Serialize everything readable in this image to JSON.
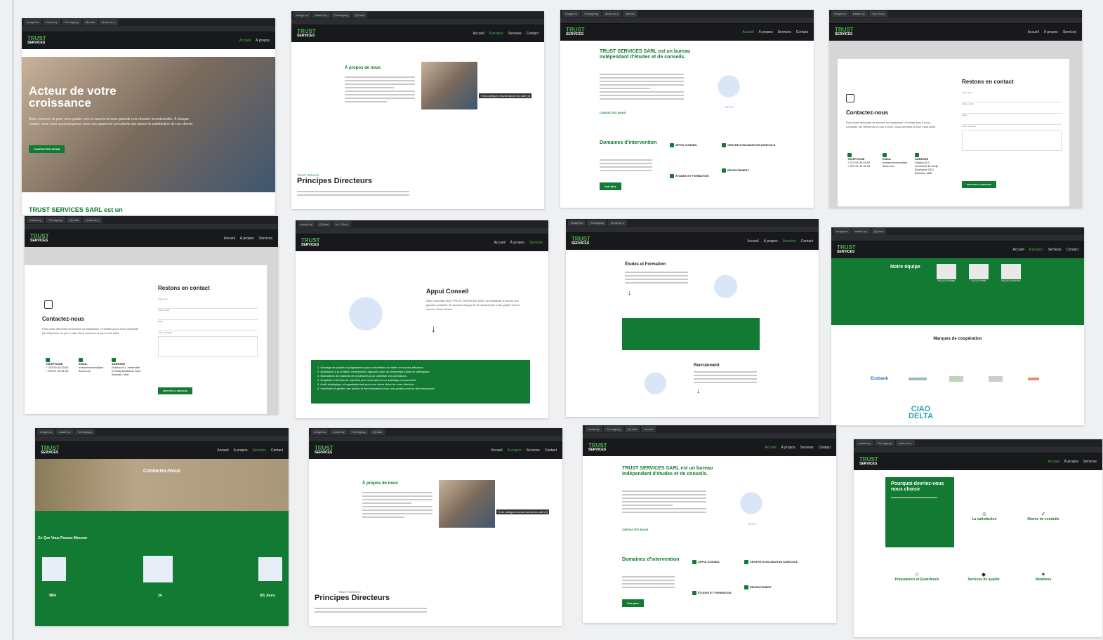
{
  "tabs": [
    "Image tra",
    "ewast loy",
    "Témoignag",
    "(3) Asal",
    "photo de p",
    "tra - Rech",
    "batmail",
    "Sites & ser",
    "Your Repo",
    "Accueil"
  ],
  "nav": {
    "home": "Accueil",
    "about": "À propos",
    "services": "Services",
    "contact": "Contact"
  },
  "logo": {
    "line1": "TRUST",
    "line2": "SERVICES"
  },
  "hero": {
    "title": "Acteur de votre croissance",
    "text": "Nous sommes là pour vous guider vers le succès et vous garantir une réussite incontestable. À chaque instant, nous vous accompagnons avec une approche percutante qui assure la satisfaction de nos clients.",
    "button": "CONTACTEZ-NOUS",
    "below": "TRUST SERVICES SARL est un"
  },
  "about": {
    "title": "À propos de nous",
    "caption": "Trois collègues travail durant du café (3)",
    "tag": "TRUST SERVICE",
    "principles": "Principes Directeurs"
  },
  "intro": {
    "title": "TRUST SERVICES SARL est un bureau indépendant d'études et de conseils.",
    "link": "CONTACTEZ-NOUS",
    "badge": "TRUST",
    "domains": "Domaines d'intervention",
    "more": "Voir plus",
    "d1": "APPUI CONSEIL",
    "d2": "CENTRE D'INCUBATION AGRICOLE",
    "d3": "ÉTUDES ET FORMATION",
    "d4": "RECRUTEMENT"
  },
  "contact": {
    "title": "Restons en contact",
    "left": "Contactez-nous",
    "text": "Pour toute demande de service ou assistance, n'hésitez pas à nous contacter par téléphone ou par e-mail. Nous sommes là pour vous aider.",
    "f_name": "Votre nom",
    "f_mail": "Votre e-mail",
    "f_obj": "Objet",
    "f_msg": "Votre message",
    "send": "ENVOYER LE MESSAGE",
    "tel_label": "TÉLÉPHONE",
    "tel": "+ 223 90 34 53 60",
    "tel2": "+ 223 91 45 56 33",
    "mail_label": "EMAIL",
    "mail": "trustservicesml@ba",
    "mail2": "ffooll.com",
    "addr_label": "ADRESSE",
    "addr": "Sotuba ACI, Immeuble El Hadji Boubacar SAO Bamako, Mali"
  },
  "appui": {
    "title": "Appui Conseil",
    "text": "Notre expertise chez TRUST SERVICES SARL se manifeste à travers une gamme complète de services d'appui et de conseil pour vous guider vers le succès. Nous offrons :",
    "l1": "1. Montage de projets et programmes pour concrétiser vos idées en succès efficaces.",
    "l2": "2. Assistance à la création d'entreprises agricoles pour un démarrage solide et stratégique.",
    "l3": "3. Élaboration de manuels de procédures pour optimiser vos opérations.",
    "l4": "4. Enquêtes et études de marchés pour vous donner un avantage concurrentiel.",
    "l5": "5. Audit stratégique et organisationnel pour une vision claire de votre direction.",
    "l6": "6. Inventaire et gestion des stocks et immobilisations pour une gestion précise des ressources."
  },
  "etudes": {
    "title": "Études et Formation",
    "recr": "Recrutement"
  },
  "team": {
    "title": "Notre équipe",
    "m1": "Boubacar NOMBE",
    "m2": "Toumani NOBE",
    "m3": "Mamadou DIAKARA",
    "marques": "Marques de coopération",
    "b1": "Ecobank",
    "b2": "CIAO",
    "b3": "DELTA"
  },
  "contactnous": {
    "title": "Contactez-Nous",
    "sub": "Ce Que Vous Pouvez Mesurer",
    "s1v": "98%",
    "s2v": "24",
    "s3v": "8/5 Jours"
  },
  "why": {
    "title": "Pourquoi devriez-vous nous choisir",
    "c1": "La satisfaction",
    "c2": "Norme de conduite",
    "c3": "Polyvalence et Expérience",
    "c4": "Services de qualité",
    "c5": "Relations"
  },
  "colors": {
    "green": "#127a32",
    "accent": "#49b649",
    "dark": "#17191c"
  }
}
